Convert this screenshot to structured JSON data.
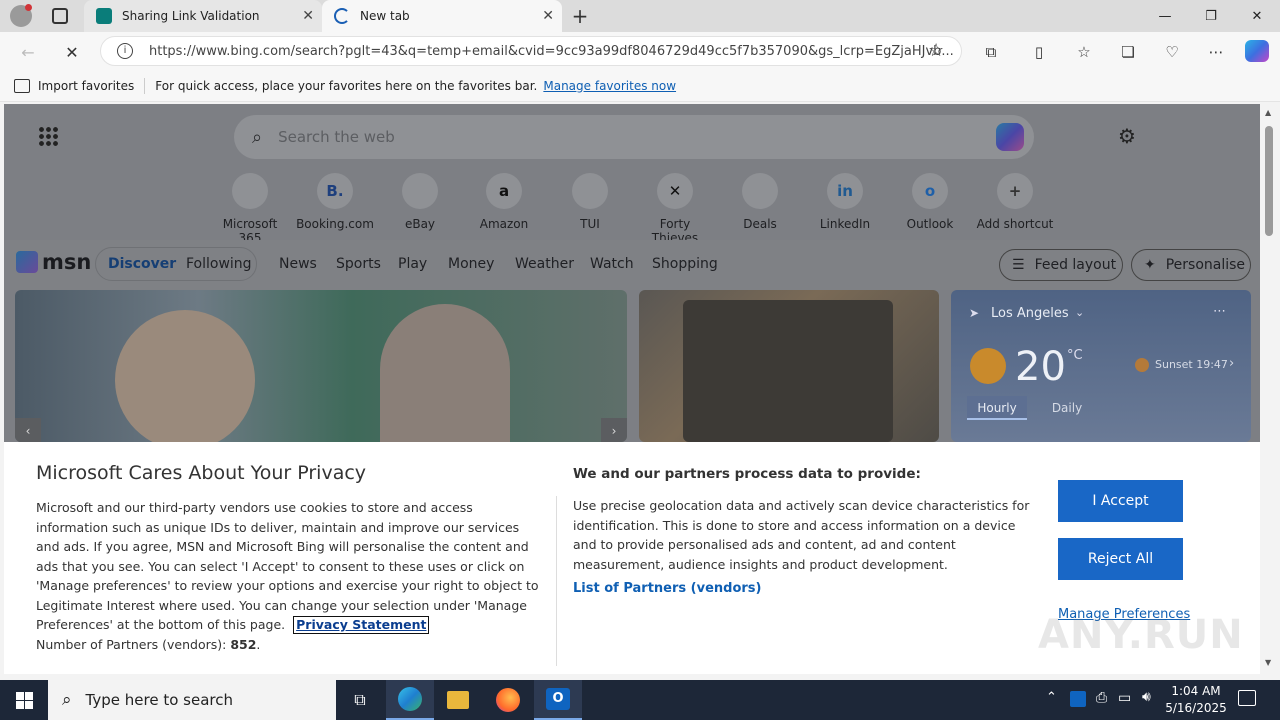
{
  "browser": {
    "tabs": [
      {
        "title": "Sharing Link Validation"
      },
      {
        "title": "New tab"
      }
    ],
    "new_tab_symbol": "+",
    "url": "https://www.bing.com/search?pglt=43&q=temp+email&cvid=9cc93a99df8046729d49cc5f7b357090&gs_lcrp=EgZjaHJvb...",
    "favorites": {
      "import_label": "Import favorites",
      "hint": "For quick access, place your favorites here on the favorites bar.",
      "manage_link": "Manage favorites now"
    }
  },
  "newtab": {
    "search_placeholder": "Search the web",
    "shortcuts": [
      {
        "label": "Microsoft 365",
        "glyph": "",
        "color": "#7b6cc4"
      },
      {
        "label": "Booking.com",
        "glyph": "B.",
        "color": "#1e3f7d"
      },
      {
        "label": "eBay",
        "glyph": "",
        "color": "#c8a020"
      },
      {
        "label": "Amazon",
        "glyph": "a",
        "color": "#111111"
      },
      {
        "label": "TUI",
        "glyph": "",
        "color": "#3f6fb0"
      },
      {
        "label": "Forty Thieves",
        "glyph": "✕",
        "color": "#111111"
      },
      {
        "label": "Deals",
        "glyph": "",
        "color": "#c9602a"
      },
      {
        "label": "LinkedIn",
        "glyph": "in",
        "color": "#205a91"
      },
      {
        "label": "Outlook",
        "glyph": "o",
        "color": "#1e5fa8"
      },
      {
        "label": "Add shortcut",
        "glyph": "+",
        "color": "#333333"
      }
    ],
    "msn": {
      "logo_text": "msn",
      "tabs": [
        {
          "label": "Discover"
        },
        {
          "label": "Following"
        }
      ],
      "nav": [
        "News",
        "Sports",
        "Play",
        "Money",
        "Weather",
        "Watch",
        "Shopping"
      ],
      "feed_layout": "Feed layout",
      "personalise": "Personalise"
    },
    "weather": {
      "location": "Los Angeles",
      "temp": "20",
      "unit": "°C",
      "sunset": "Sunset 19:47",
      "tabs": [
        "Hourly",
        "Daily"
      ]
    }
  },
  "privacy": {
    "title": "Microsoft Cares About Your Privacy",
    "body": "Microsoft and our third-party vendors use cookies to store and access information such as unique IDs to deliver, maintain and improve our services and ads. If you agree, MSN and Microsoft Bing will personalise the content and ads that you see. You can select 'I Accept' to consent to these uses or click on 'Manage preferences' to review your options and exercise your right to object to Legitimate Interest where used.  You can change your selection under 'Manage Preferences' at the bottom of this page.",
    "privacy_link": "Privacy Statement",
    "partners_label": "Number of Partners (vendors):",
    "partners_count": "852",
    "partners_suffix": ".",
    "purpose_title": "We and our partners process data to provide:",
    "purpose_body": "Use precise geolocation data and actively scan device characteristics for identification. This is done to store and access information on a device and to provide personalised ads and content, ad and content measurement, audience insights and product development.",
    "vendors_link": "List of Partners (vendors)",
    "accept": "I Accept",
    "reject": "Reject All",
    "manage": "Manage Preferences"
  },
  "watermark": "ANY.RUN",
  "taskbar": {
    "search_placeholder": "Type here to search",
    "time": "1:04 AM",
    "date": "5/16/2025"
  },
  "colors": {
    "accent": "#1967c6",
    "link": "#0f5fb3",
    "taskbar": "#1d2738"
  }
}
